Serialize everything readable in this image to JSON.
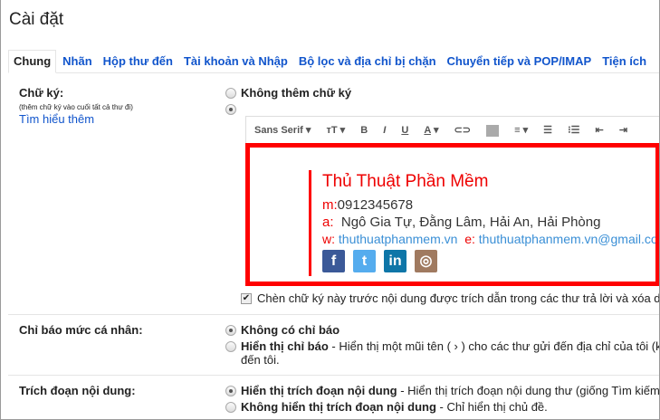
{
  "title": "Cài đặt",
  "tabs": [
    "Chung",
    "Nhãn",
    "Hộp thư đến",
    "Tài khoản và Nhập",
    "Bộ lọc và địa chỉ bị chặn",
    "Chuyển tiếp và POP/IMAP",
    "Tiện ích"
  ],
  "signature": {
    "label": "Chữ ký:",
    "sub": "(thêm chữ ký vào cuối tất cả thư đi)",
    "learn_more": "Tìm hiểu thêm",
    "no_signature": "Không thêm chữ ký",
    "toolbar": {
      "font": "Sans Serif",
      "size": "тT",
      "bold": "B",
      "italic": "I",
      "underline": "U",
      "color": "A"
    },
    "content": {
      "name": "Thủ Thuật Phần Mềm",
      "m_key": "m:",
      "phone": "0912345678",
      "a_key": "a:",
      "address": "Ngô Gia Tự, Đằng Lâm, Hải An, Hải Phòng",
      "w_key": "w:",
      "website": "thuthuatphanmem.vn",
      "e_key": "e:",
      "email": "thuthuatphanmem.vn@gmail.com",
      "social": [
        {
          "name": "facebook",
          "glyph": "f",
          "color": "#3b5998"
        },
        {
          "name": "twitter",
          "glyph": "t",
          "color": "#55acee"
        },
        {
          "name": "linkedin",
          "glyph": "in",
          "color": "#0e76a8"
        },
        {
          "name": "instagram",
          "glyph": "◎",
          "color": "#a07a60"
        }
      ]
    },
    "insert_before_quote": "Chèn chữ ký này trước nội dung được trích dẫn trong các thư trả lời và xóa dòng \"--\" đứng trước nó."
  },
  "personal": {
    "label": "Chỉ báo mức cá nhân:",
    "opt1": "Không có chỉ báo",
    "opt2_bold": "Hiển thị chỉ báo",
    "opt2_desc": " - Hiển thị một mũi tên ( › ) cho các thư gửi đến địa chỉ của tôi (không phải danh sách gửi thư) và dấu đôi ( » ) cho các thư gửi riêng",
    "opt2_cont": "đến tôi."
  },
  "snippets": {
    "label": "Trích đoạn nội dung:",
    "opt1_bold": "Hiển thị trích đoạn nội dung",
    "opt1_desc": " - Hiển thị trích đoạn nội dung thư (giống Tìm kiếm trên web của Google!).",
    "opt2_bold": "Không hiển thị trích đoạn nội dung",
    "opt2_desc": " - Chỉ hiển thị chủ đề."
  }
}
